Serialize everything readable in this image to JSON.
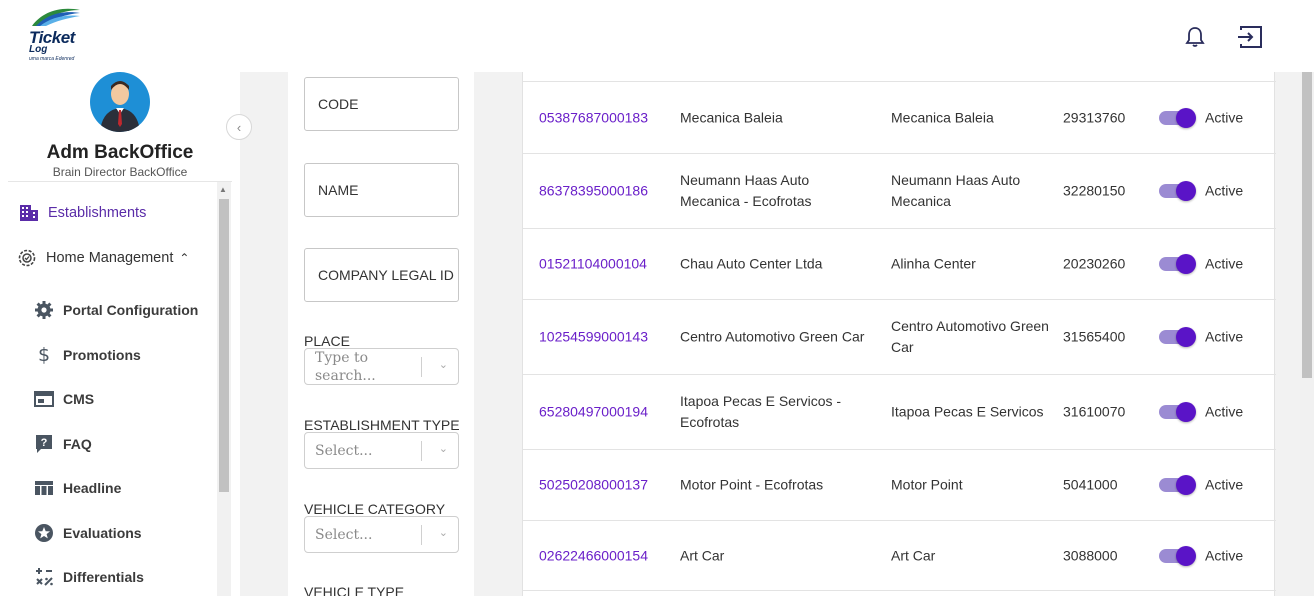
{
  "header": {
    "logo": {
      "line1": "Ticket",
      "line2": "Log",
      "tagline": "uma marca Edenred"
    },
    "icons": [
      "bell-icon",
      "logout-icon"
    ]
  },
  "sidebar": {
    "user": {
      "name": "Adm BackOffice",
      "role": "Brain Director BackOffice"
    },
    "items": [
      {
        "label": "Establishments",
        "icon": "building-icon",
        "active": true
      },
      {
        "label": "Home Management",
        "icon": "gear-icon",
        "expanded": true
      },
      {
        "label": "Portal Configuration",
        "icon": "cog-icon"
      },
      {
        "label": "Promotions",
        "icon": "dollar-icon"
      },
      {
        "label": "CMS",
        "icon": "window-icon"
      },
      {
        "label": "FAQ",
        "icon": "question-icon"
      },
      {
        "label": "Headline",
        "icon": "table-icon"
      },
      {
        "label": "Evaluations",
        "icon": "star-icon"
      },
      {
        "label": "Differentials",
        "icon": "formula-icon"
      }
    ]
  },
  "filters": {
    "code": "CODE",
    "name": "NAME",
    "legal_id": "COMPANY LEGAL ID",
    "place_label": "PLACE",
    "place_placeholder": "Type to search...",
    "establishment_type_label": "ESTABLISHMENT TYPE",
    "establishment_type_placeholder": "Select...",
    "vehicle_category_label": "VEHICLE CATEGORY",
    "vehicle_category_placeholder": "Select...",
    "vehicle_type_label": "VEHICLE TYPE"
  },
  "table": {
    "rows": [
      {
        "cnpj": "05387687000183",
        "name": "Mecanica Baleia",
        "trade": "Mecanica Baleia",
        "code": "29313760",
        "active": true,
        "status": "Active"
      },
      {
        "cnpj": "86378395000186",
        "name": "Neumann Haas Auto Mecanica - Ecofrotas",
        "trade": "Neumann Haas Auto Mecanica",
        "code": "32280150",
        "active": true,
        "status": "Active"
      },
      {
        "cnpj": "01521104000104",
        "name": "Chau Auto Center Ltda",
        "trade": "Alinha Center",
        "code": "20230260",
        "active": true,
        "status": "Active"
      },
      {
        "cnpj": "10254599000143",
        "name": "Centro Automotivo Green Car",
        "trade": "Centro Automotivo Green Car",
        "code": "31565400",
        "active": true,
        "status": "Active"
      },
      {
        "cnpj": "65280497000194",
        "name": "Itapoa Pecas E Servicos - Ecofrotas",
        "trade": "Itapoa Pecas E Servicos",
        "code": "31610070",
        "active": true,
        "status": "Active"
      },
      {
        "cnpj": "50250208000137",
        "name": "Motor Point - Ecofrotas",
        "trade": "Motor Point",
        "code": "5041000",
        "active": true,
        "status": "Active"
      },
      {
        "cnpj": "02622466000154",
        "name": "Art Car",
        "trade": "Art Car",
        "code": "3088000",
        "active": true,
        "status": "Active"
      }
    ]
  },
  "colors": {
    "accent": "#5a14c7",
    "link": "#6a1fc9",
    "toggle_track": "#9b8bd3"
  }
}
